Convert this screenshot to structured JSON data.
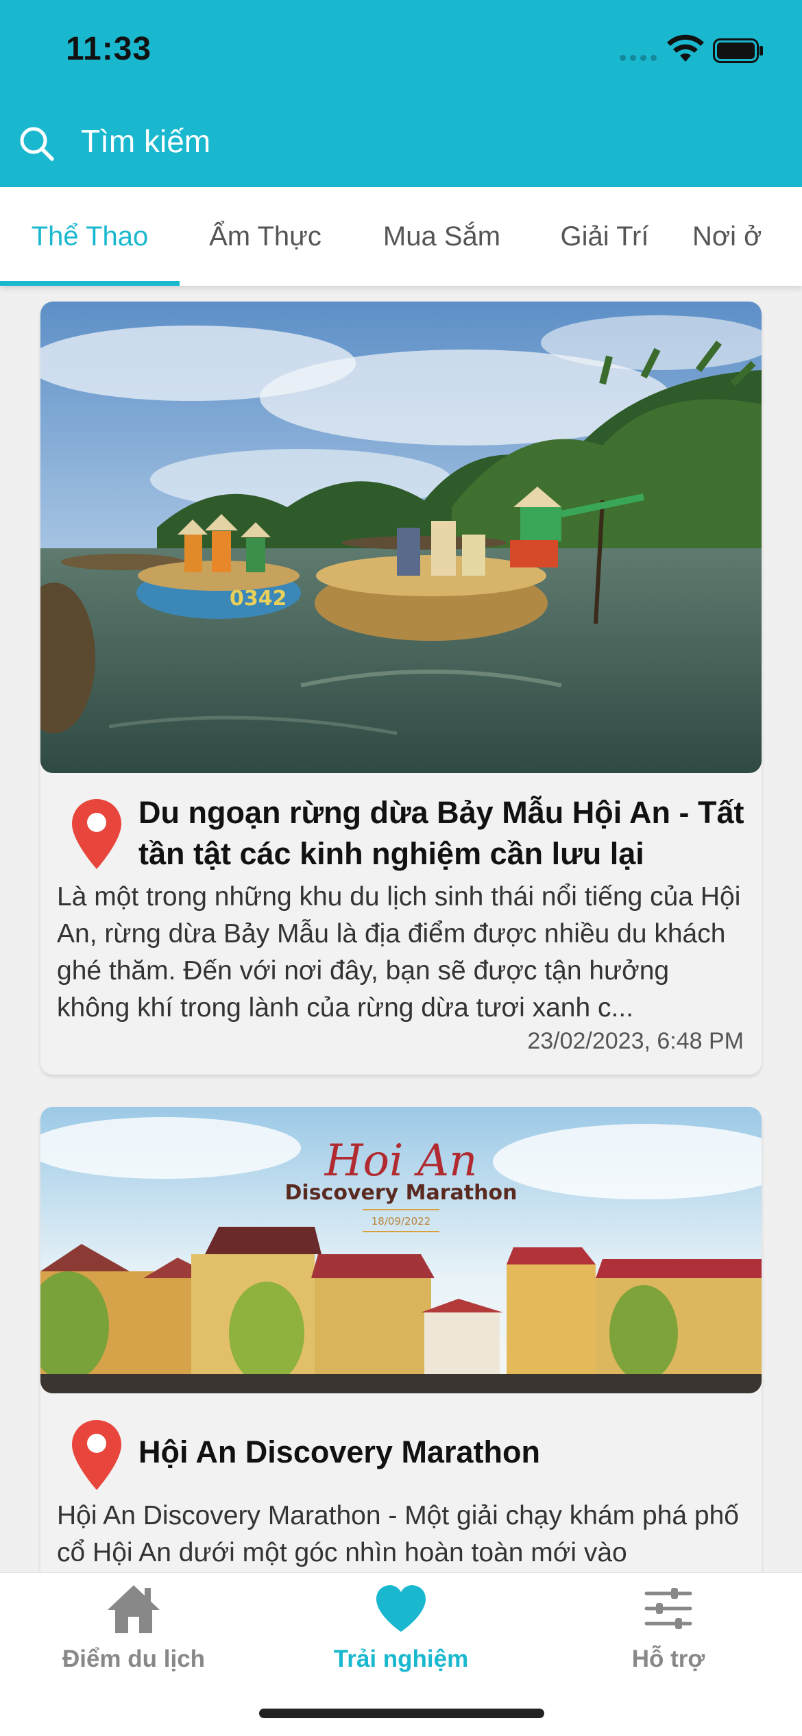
{
  "status_bar": {
    "time": "11:33"
  },
  "search": {
    "placeholder": "Tìm kiếm"
  },
  "tabs": [
    {
      "label": "Thể Thao",
      "active": true
    },
    {
      "label": "Ẩm Thực",
      "active": false
    },
    {
      "label": "Mua Sắm",
      "active": false
    },
    {
      "label": "Giải Trí",
      "active": false
    },
    {
      "label": "Nơi ở",
      "active": false
    }
  ],
  "cards": [
    {
      "title": "Du ngoạn rừng dừa Bảy Mẫu Hội An - Tất tần tật các kinh nghiệm cần lưu lại",
      "description": "Là một trong những khu du lịch sinh thái nổi tiếng của Hội An, rừng dừa Bảy Mẫu là địa điểm được nhiều du khách ghé thăm. Đến với nơi đây, bạn sẽ được tận hưởng không khí trong lành của rừng dừa tươi xanh c...",
      "date": "23/02/2023, 6:48 PM"
    },
    {
      "title": "Hội An Discovery Marathon",
      "description": "Hội An Discovery Marathon - Một giải chạy khám phá phố cổ Hội An dưới một góc nhìn hoàn toàn mới vào",
      "image_text": {
        "script_title": "Hoi An",
        "subtitle": "Discovery Marathon",
        "date": "18/09/2022"
      }
    }
  ],
  "bottom_nav": [
    {
      "label": "Điểm du lịch",
      "icon": "home-icon",
      "active": false
    },
    {
      "label": "Trải nghiệm",
      "icon": "heart-icon",
      "active": true
    },
    {
      "label": "Hỗ trợ",
      "icon": "sliders-icon",
      "active": false
    }
  ],
  "colors": {
    "accent": "#1ab8cf",
    "pin": "#e8453c",
    "inactive": "#888888"
  }
}
